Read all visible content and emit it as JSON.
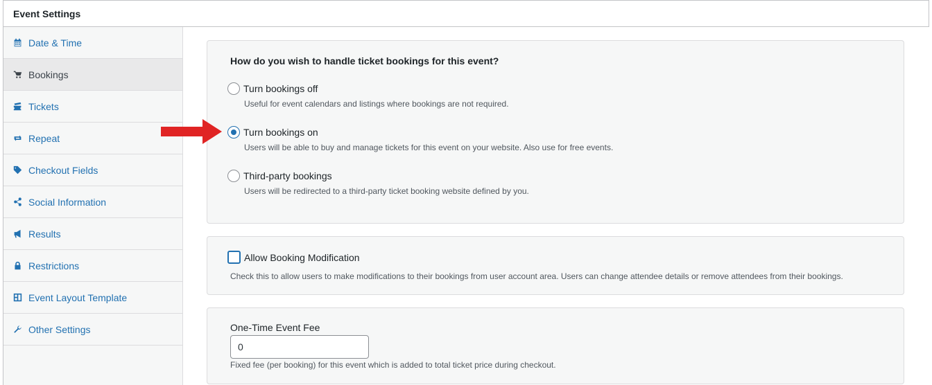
{
  "panel": {
    "title": "Event Settings"
  },
  "sidebar": {
    "items": [
      {
        "label": "Date & Time",
        "icon": "calendar-icon",
        "active": false
      },
      {
        "label": "Bookings",
        "icon": "cart-icon",
        "active": true
      },
      {
        "label": "Tickets",
        "icon": "tickets-icon",
        "active": false
      },
      {
        "label": "Repeat",
        "icon": "repeat-icon",
        "active": false
      },
      {
        "label": "Checkout Fields",
        "icon": "tag-icon",
        "active": false
      },
      {
        "label": "Social Information",
        "icon": "share-icon",
        "active": false
      },
      {
        "label": "Results",
        "icon": "megaphone-icon",
        "active": false
      },
      {
        "label": "Restrictions",
        "icon": "lock-icon",
        "active": false
      },
      {
        "label": "Event Layout Template",
        "icon": "layout-icon",
        "active": false
      },
      {
        "label": "Other Settings",
        "icon": "wrench-icon",
        "active": false
      }
    ]
  },
  "bookings": {
    "question": "How do you wish to handle ticket bookings for this event?",
    "options": [
      {
        "label": "Turn bookings off",
        "description": "Useful for event calendars and listings where bookings are not required.",
        "checked": false
      },
      {
        "label": "Turn bookings on",
        "description": "Users will be able to buy and manage tickets for this event on your website. Also use for free events.",
        "checked": true
      },
      {
        "label": "Third-party bookings",
        "description": "Users will be redirected to a third-party ticket booking website defined by you.",
        "checked": false
      }
    ]
  },
  "modification": {
    "label": "Allow Booking Modification",
    "description": "Check this to allow users to make modifications to their bookings from user account area. Users can change attendee details or remove attendees from their bookings.",
    "checked": false
  },
  "fee": {
    "label": "One-Time Event Fee",
    "value": "0",
    "description": "Fixed fee (per booking) for this event which is added to total ticket price during checkout."
  },
  "annotation": {
    "arrow_color": "#e02424"
  },
  "colors": {
    "accent": "#2271b1",
    "text": "#1d2327",
    "muted": "#50575e"
  }
}
